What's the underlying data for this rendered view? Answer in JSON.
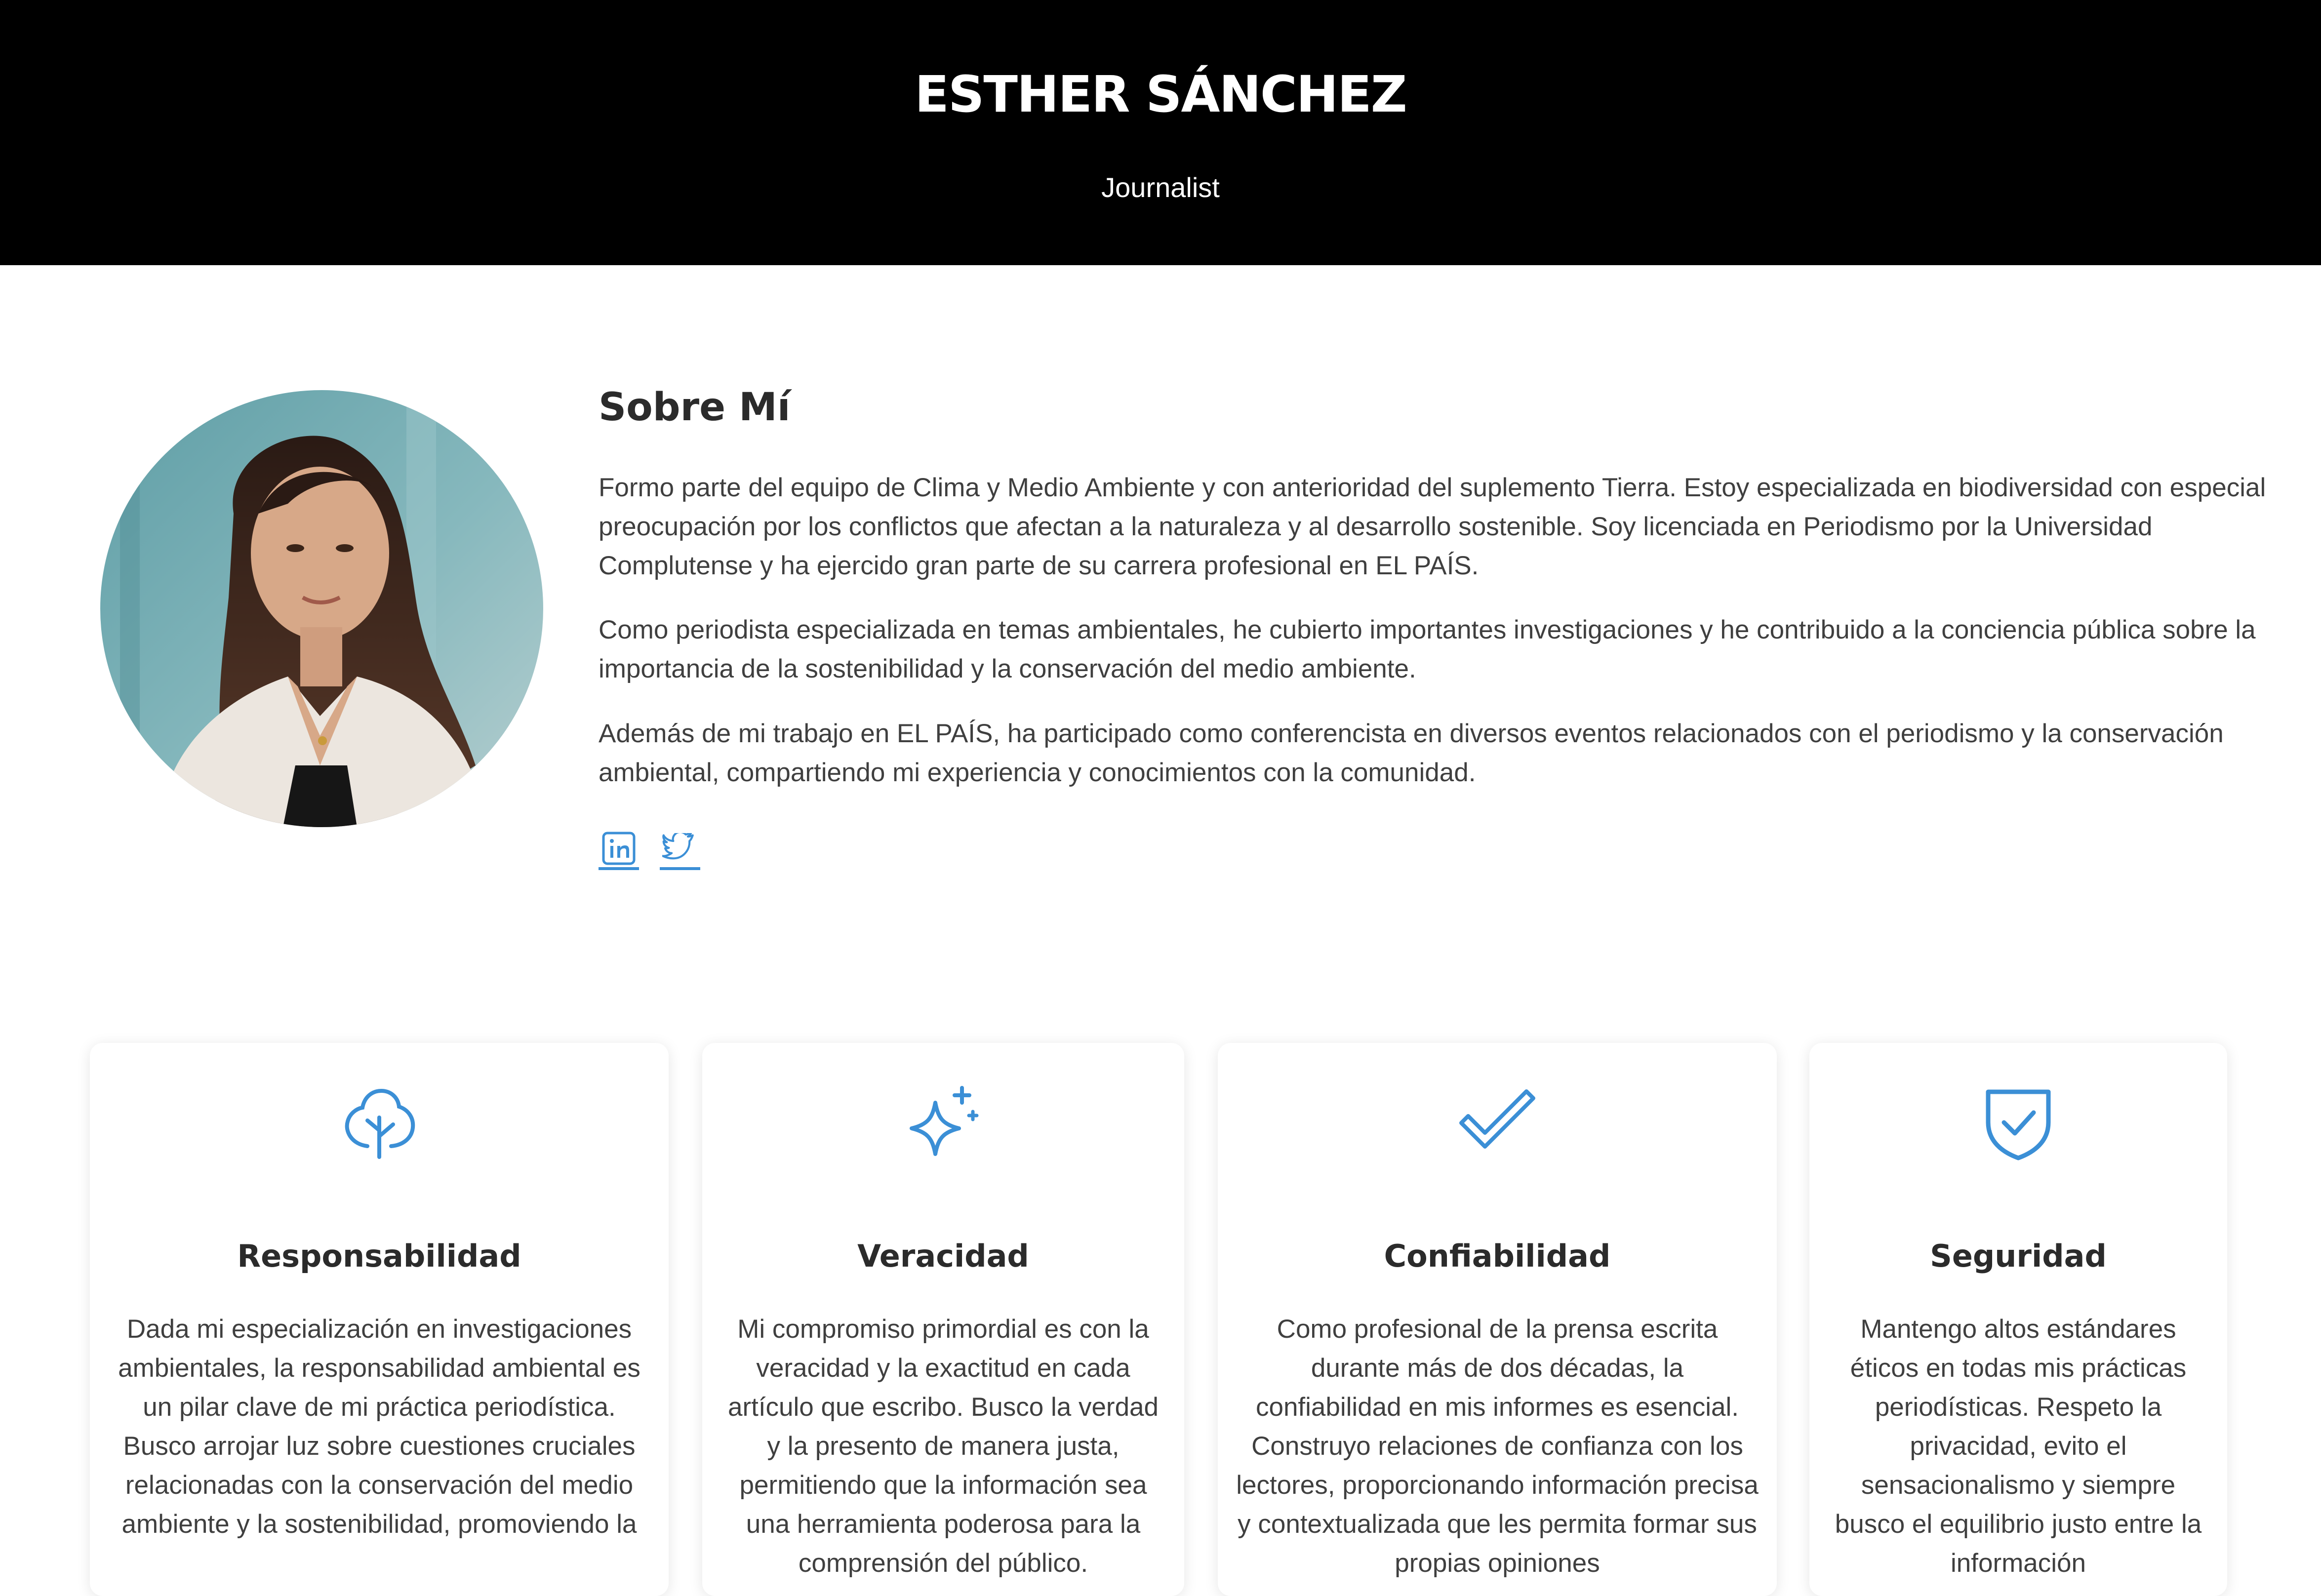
{
  "header": {
    "name": "ESTHER SÁNCHEZ",
    "role": "Journalist"
  },
  "about": {
    "title": "Sobre Mí",
    "paragraphs": [
      "Formo parte del equipo de Clima y Medio Ambiente y con anterioridad del suplemento Tierra. Estoy especializada en biodiversidad con especial preocupación por los conflictos que afectan a la naturaleza y al desarrollo sostenible. Soy licenciada en Periodismo por la Universidad Complutense y ha ejercido gran parte de su carrera profesional en EL PAÍS.",
      "Como periodista especializada en temas ambientales, he cubierto importantes investigaciones y he contribuido a la conciencia pública sobre la importancia de la sostenibilidad y la conservación del medio ambiente.",
      "Además de mi trabajo en EL PAÍS, ha participado como conferencista en diversos eventos relacionados con el periodismo y la conservación ambiental, compartiendo mi experiencia y conocimientos con la comunidad."
    ]
  },
  "social": {
    "items": [
      {
        "icon": "linkedin-icon"
      },
      {
        "icon": "twitter-icon"
      }
    ]
  },
  "values": [
    {
      "icon": "tree-icon",
      "title": "Responsabilidad",
      "text": "Dada mi especialización en investigaciones ambientales, la responsabilidad ambiental es un pilar clave de mi práctica periodística. Busco arrojar luz sobre cuestiones cruciales relacionadas con la conservación del medio ambiente y la sostenibilidad, promoviendo la"
    },
    {
      "icon": "sparkle-icon",
      "title": "Veracidad",
      "text": "Mi compromiso primordial es con la veracidad y la exactitud en cada artículo que escribo. Busco la verdad y la presento de manera justa, permitiendo que la información sea una herramienta poderosa para la comprensión del público."
    },
    {
      "icon": "check-icon",
      "title": "Confiabilidad",
      "text": "Como profesional de la prensa escrita durante más de dos décadas, la confiabilidad en mis informes es esencial. Construyo relaciones de confianza con los lectores, proporcionando información precisa y contextualizada que les permita formar sus propias opiniones"
    },
    {
      "icon": "shield-check-icon",
      "title": "Seguridad",
      "text": "Mantengo altos estándares éticos en todas mis prácticas periodísticas. Respeto la privacidad, evito el sensacionalismo y siempre busco el equilibrio justo entre la información"
    }
  ],
  "colors": {
    "header_bg": "#000000",
    "accent": "#3b8fd6",
    "text": "#3f3f3f"
  }
}
